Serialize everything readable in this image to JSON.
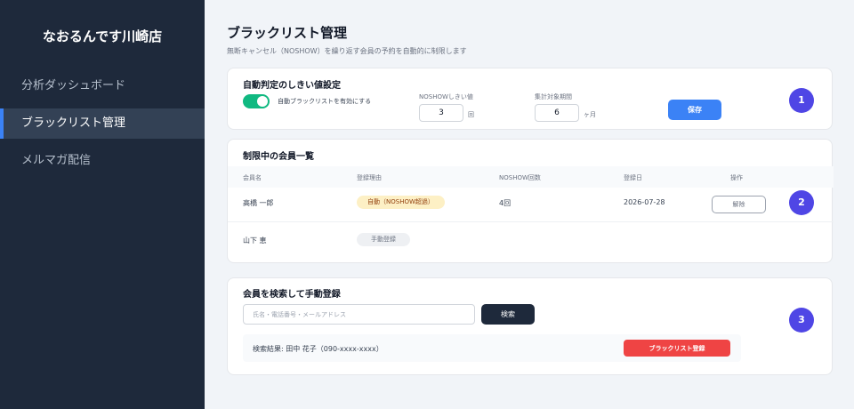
{
  "sidebar": {
    "store_name": "なおるんです川崎店",
    "items": [
      {
        "label": "分析ダッシュボード"
      },
      {
        "label": "ブラックリスト管理"
      },
      {
        "label": "メルマガ配信"
      }
    ]
  },
  "header": {
    "title": "ブラックリスト管理",
    "subtitle": "無断キャンセル（NOSHOW）を繰り返す会員の予約を自動的に制限します"
  },
  "threshold": {
    "title": "自動判定のしきい値設定",
    "toggle_label": "自動ブラックリストを有効にする",
    "toggle_on": true,
    "noshow_label": "NOSHOWしきい値",
    "noshow_value": "3",
    "noshow_unit": "回",
    "period_label": "集計対象期間",
    "period_value": "6",
    "period_unit": "ヶ月",
    "save_label": "保存",
    "step": "1"
  },
  "members": {
    "title": "制限中の会員一覧",
    "columns": [
      "会員名",
      "登録理由",
      "NOSHOW回数",
      "登録日",
      "操作"
    ],
    "rows": [
      {
        "name": "高橋 一郎",
        "reason": "自動（NOSHOW超過）",
        "count": "4回",
        "date": "2026-07-28",
        "action": "解除"
      },
      {
        "name": "山下 恵",
        "reason": "手動登録",
        "count": "",
        "date": "",
        "action": ""
      }
    ],
    "step": "2"
  },
  "manual": {
    "title": "会員を検索して手動登録",
    "search_placeholder": "氏名・電話番号・メールアドレス",
    "search_button": "検索",
    "result_text": "検索結果: 田中 花子（090-xxxx-xxxx）",
    "register_button": "ブラックリスト登録",
    "step": "3"
  },
  "colors": {
    "sidebar_bg": "#1e293b",
    "accent": "#3b82f6",
    "toggle_on": "#10b981",
    "step_badge": "#4f46e5",
    "danger": "#ef4444"
  }
}
